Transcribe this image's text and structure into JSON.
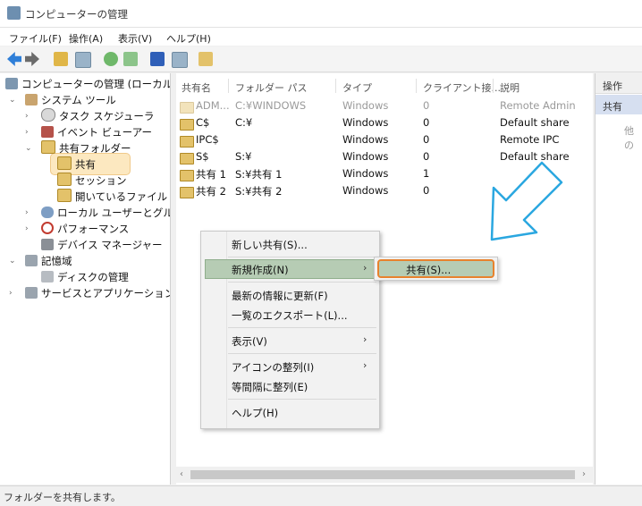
{
  "window": {
    "title": "コンピューターの管理"
  },
  "menu": [
    "ファイル(F)",
    "操作(A)",
    "表示(V)",
    "ヘルプ(H)"
  ],
  "tree": {
    "root": "コンピューターの管理 (ローカル)",
    "system_tools": "システム ツール",
    "task_scheduler": "タスク スケジューラ",
    "event_viewer": "イベント ビューアー",
    "shared_folders": "共有フォルダー",
    "shares": "共有",
    "sessions": "セッション",
    "open_files": "開いているファイル",
    "local_users": "ローカル ユーザーとグループ",
    "performance": "パフォーマンス",
    "device_manager": "デバイス マネージャー",
    "storage": "記憶域",
    "disk_management": "ディスクの管理",
    "services_apps": "サービスとアプリケーション"
  },
  "columns": [
    "共有名",
    "フォルダー パス",
    "タイプ",
    "クライアント接...",
    "説明"
  ],
  "rows": [
    [
      "ADM...",
      "C:¥WINDOWS",
      "Windows",
      "0",
      "Remote Admin"
    ],
    [
      "C$",
      "C:¥",
      "Windows",
      "0",
      "Default share"
    ],
    [
      "IPC$",
      "",
      "Windows",
      "0",
      "Remote IPC"
    ],
    [
      "S$",
      "S:¥",
      "Windows",
      "0",
      "Default share"
    ],
    [
      "共有 1",
      "S:¥共有 1",
      "Windows",
      "1",
      ""
    ],
    [
      "共有 2",
      "S:¥共有 2",
      "Windows",
      "0",
      ""
    ]
  ],
  "ops_panel": {
    "header": "操作",
    "item": "共有",
    "more": "他の"
  },
  "context_menu": {
    "new_share": "新しい共有(S)...",
    "new": "新規作成(N)",
    "refresh": "最新の情報に更新(F)",
    "export": "一覧のエクスポート(L)...",
    "view": "表示(V)",
    "arrange": "アイコンの整列(I)",
    "line_up": "等間隔に整列(E)",
    "help": "ヘルプ(H)"
  },
  "submenu": {
    "share": "共有(S)..."
  },
  "status": "フォルダーを共有します。",
  "colors": {
    "highlight": "#fce8c0",
    "menu_selected": "#b6ccb4",
    "accent_outline": "#e8822d",
    "arrow": "#2aa7e0"
  }
}
